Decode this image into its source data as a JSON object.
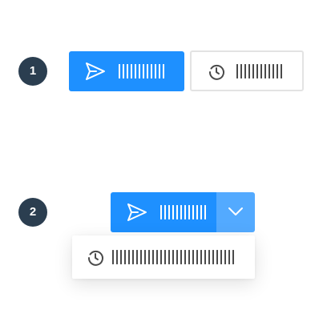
{
  "badges": {
    "first": "1",
    "second": "2"
  },
  "example_1": {
    "primary_button": {
      "icon": "send-icon",
      "placeholder_bar_count": 12,
      "color": "#1e90ff"
    },
    "secondary_button": {
      "icon": "clock-icon",
      "placeholder_bar_count": 12,
      "border_color": "#e3e3e3"
    }
  },
  "example_2": {
    "split_button": {
      "icon": "send-icon",
      "placeholder_bar_count": 12,
      "color": "#1e90ff",
      "caret_icon": "chevron-down-icon",
      "caret_color": "#53aaff"
    },
    "dropdown_item": {
      "icon": "clock-icon",
      "placeholder_bar_count": 31
    }
  },
  "colors": {
    "badge": "#2b3e50",
    "text_dark": "#4a4a4a",
    "text_light": "#ffffff"
  }
}
